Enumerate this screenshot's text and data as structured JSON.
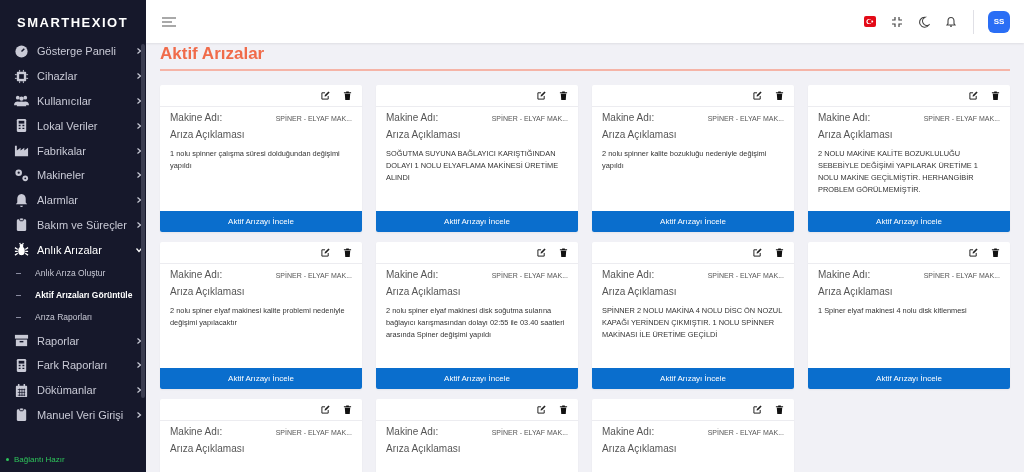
{
  "sidebar": {
    "logo": "SMARTHEXIOT",
    "items": [
      {
        "label": "Gösterge Paneli",
        "expanded": false
      },
      {
        "label": "Cihazlar",
        "expanded": false
      },
      {
        "label": "Kullanıcılar",
        "expanded": false
      },
      {
        "label": "Lokal Veriler",
        "expanded": false
      },
      {
        "label": "Fabrikalar",
        "expanded": false
      },
      {
        "label": "Makineler",
        "expanded": false
      },
      {
        "label": "Alarmlar",
        "expanded": false
      },
      {
        "label": "Bakım ve Süreçler",
        "expanded": false
      },
      {
        "label": "Anlık Arızalar",
        "expanded": true,
        "children": [
          {
            "label": "Anlık Arıza Oluştur",
            "selected": false
          },
          {
            "label": "Aktif Arızaları Görüntüle",
            "selected": true
          },
          {
            "label": "Arıza Raporları",
            "selected": false
          }
        ]
      },
      {
        "label": "Raporlar",
        "expanded": false
      },
      {
        "label": "Fark Raporları",
        "expanded": false
      },
      {
        "label": "Dökümanlar",
        "expanded": false
      },
      {
        "label": "Manuel Veri Girişi",
        "expanded": false
      }
    ],
    "status": "Bağlantı Hazır"
  },
  "header": {
    "avatar": "SS"
  },
  "page": {
    "title": "Aktif Arızalar",
    "cards": [
      {
        "machine_label": "Makine Adı:",
        "machine_name": "SPİNER - ELYAF MAK...",
        "desc_label": "Arıza Açıklaması",
        "description": "1 nolu spinner çalışma süresi dolduğundan değişimi yapıldı",
        "button": "Aktif Arızayı İncele"
      },
      {
        "machine_label": "Makine Adı:",
        "machine_name": "SPİNER - ELYAF MAK...",
        "desc_label": "Arıza Açıklaması",
        "description": "SOĞUTMA SUYUNA BAĞLAYICI KARIŞTIĞINDAN DOLAYI 1 NOLU ELYAFLAMA MAKİNESİ ÜRETİME ALINDI",
        "button": "Aktif Arızayı İncele"
      },
      {
        "machine_label": "Makine Adı:",
        "machine_name": "SPİNER - ELYAF MAK...",
        "desc_label": "Arıza Açıklaması",
        "description": "2 nolu spinner kalite bozukluğu nedeniyle değişimi yapıldı",
        "button": "Aktif Arızayı İncele"
      },
      {
        "machine_label": "Makine Adı:",
        "machine_name": "SPİNER - ELYAF MAK...",
        "desc_label": "Arıza Açıklaması",
        "description": "2 NOLU MAKİNE KALİTE BOZUKLULUĞU SEBEBİYLE DEĞİŞİMİ YAPILARAK ÜRETİME 1 NOLU MAKİNE GEÇİLMİŞTİR. HERHANGİBİR PROBLEM GÖRÜLMEMİŞTİR.",
        "button": "Aktif Arızayı İncele"
      },
      {
        "machine_label": "Makine Adı:",
        "machine_name": "SPİNER - ELYAF MAK...",
        "desc_label": "Arıza Açıklaması",
        "description": "2 nolu spiner elyaf makinesi kalite problemi nedeniyle değişimi yapılacaktır",
        "button": "Aktif Arızayı İncele"
      },
      {
        "machine_label": "Makine Adı:",
        "machine_name": "SPİNER - ELYAF MAK...",
        "desc_label": "Arıza Açıklaması",
        "description": "2 nolu spiner elyaf makinesi disk soğutma sularına bağlayıcı karışmasından dolayı 02:55 ile 03.40 saatleri arasında Spiner değişimi yapıldı",
        "button": "Aktif Arızayı İncele"
      },
      {
        "machine_label": "Makine Adı:",
        "machine_name": "SPİNER - ELYAF MAK...",
        "desc_label": "Arıza Açıklaması",
        "description": "SPİNNER 2 NOLU MAKİNA 4 NOLU DİSC ÖN NOZUL KAPAĞI YERİNDEN ÇIKMIŞTIR. 1 NOLU SPİNNER MAKİNASI İLE ÜRETİME GEÇİLDİ",
        "button": "Aktif Arızayı İncele"
      },
      {
        "machine_label": "Makine Adı:",
        "machine_name": "SPİNER - ELYAF MAK...",
        "desc_label": "Arıza Açıklaması",
        "description": "1 Spiner elyaf makinesi 4 nolu disk kitlenmesi",
        "button": "Aktif Arızayı İncele"
      },
      {
        "machine_label": "Makine Adı:",
        "machine_name": "SPİNER - ELYAF MAK...",
        "desc_label": "Arıza Açıklaması"
      },
      {
        "machine_label": "Makine Adı:",
        "machine_name": "SPİNER - ELYAF MAK...",
        "desc_label": "Arıza Açıklaması"
      },
      {
        "machine_label": "Makine Adı:",
        "machine_name": "SPİNER - ELYAF MAK...",
        "desc_label": "Arıza Açıklaması"
      }
    ]
  }
}
